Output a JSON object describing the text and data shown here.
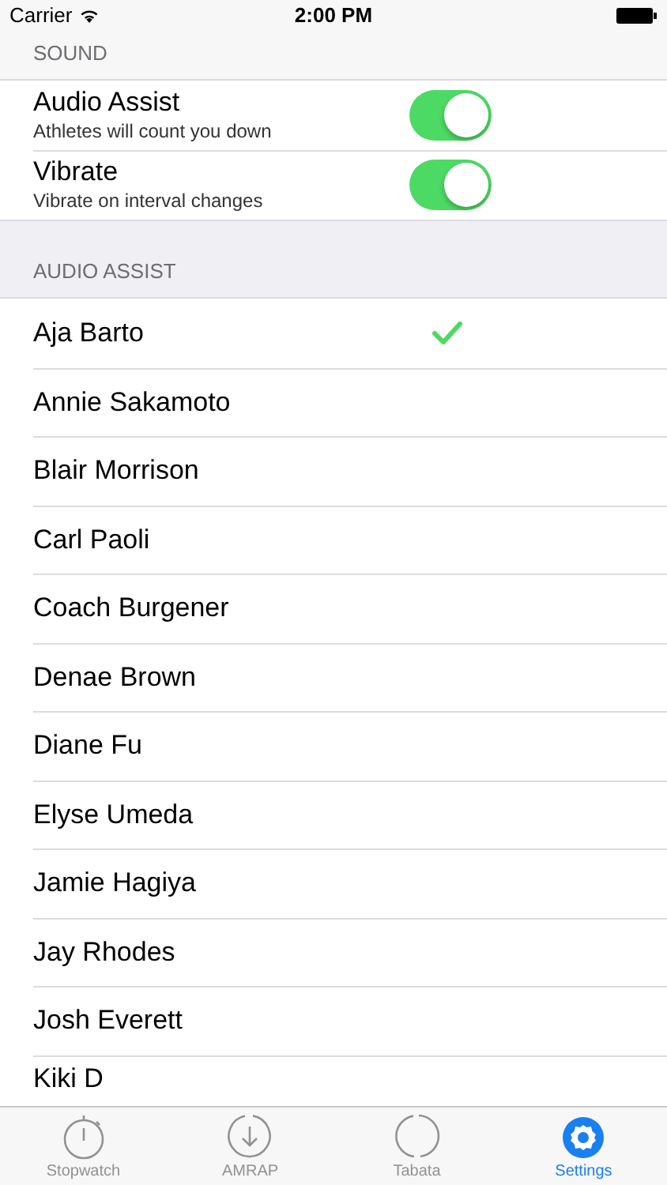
{
  "status_bar": {
    "carrier": "Carrier",
    "time": "2:00 PM"
  },
  "sound_section": {
    "header": "SOUND",
    "settings": [
      {
        "title": "Audio Assist",
        "subtitle": "Athletes will count you down",
        "on": true
      },
      {
        "title": "Vibrate",
        "subtitle": "Vibrate on interval changes",
        "on": true
      }
    ]
  },
  "audio_assist_section": {
    "header": "AUDIO ASSIST",
    "voices": [
      {
        "name": "Aja Barto",
        "selected": true
      },
      {
        "name": "Annie Sakamoto",
        "selected": false
      },
      {
        "name": "Blair Morrison",
        "selected": false
      },
      {
        "name": "Carl Paoli",
        "selected": false
      },
      {
        "name": "Coach Burgener",
        "selected": false
      },
      {
        "name": "Denae Brown",
        "selected": false
      },
      {
        "name": "Diane Fu",
        "selected": false
      },
      {
        "name": "Elyse Umeda",
        "selected": false
      },
      {
        "name": "Jamie Hagiya",
        "selected": false
      },
      {
        "name": "Jay Rhodes",
        "selected": false
      },
      {
        "name": "Josh Everett",
        "selected": false
      },
      {
        "name": "Kiki D",
        "selected": false
      }
    ]
  },
  "tab_bar": [
    {
      "kind": "stopwatch",
      "label": "Stopwatch",
      "selected": false
    },
    {
      "kind": "amrap",
      "label": "AMRAP",
      "selected": false
    },
    {
      "kind": "tabata",
      "label": "Tabata",
      "selected": false
    },
    {
      "kind": "settings",
      "label": "Settings",
      "selected": true
    }
  ]
}
